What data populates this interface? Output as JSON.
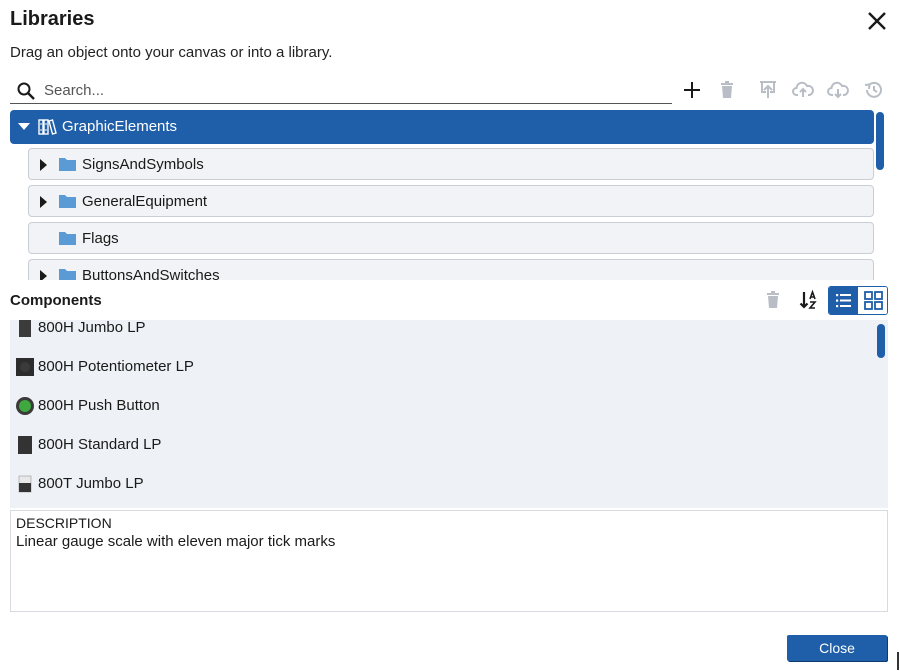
{
  "dialog": {
    "title": "Libraries",
    "subtitle": "Drag an object onto your canvas or into a library.",
    "close_icon": "close-icon"
  },
  "search": {
    "placeholder": "Search...",
    "value": ""
  },
  "toolbar": {
    "icons": [
      "add-icon",
      "trash-icon",
      "import-icon",
      "upload-icon",
      "download-icon",
      "history-icon"
    ]
  },
  "tree": {
    "root": {
      "label": "GraphicElements",
      "expanded": true
    },
    "items": [
      {
        "label": "SignsAndSymbols",
        "expandable": true
      },
      {
        "label": "GeneralEquipment",
        "expandable": true
      },
      {
        "label": "Flags",
        "expandable": false
      },
      {
        "label": "ButtonsAndSwitches",
        "expandable": true
      }
    ]
  },
  "components": {
    "header": "Components",
    "items": [
      {
        "label": "800H Jumbo LP"
      },
      {
        "label": "800H Potentiometer LP"
      },
      {
        "label": "800H Push Button"
      },
      {
        "label": "800H Standard LP"
      },
      {
        "label": "800T Jumbo LP"
      }
    ]
  },
  "description": {
    "title": "DESCRIPTION",
    "text": "Linear gauge scale with eleven major tick marks"
  },
  "footer": {
    "close_label": "Close"
  },
  "colors": {
    "accent": "#1f5ea8",
    "folder": "#5b9bd5",
    "disabled_icon": "#b9bec6"
  }
}
